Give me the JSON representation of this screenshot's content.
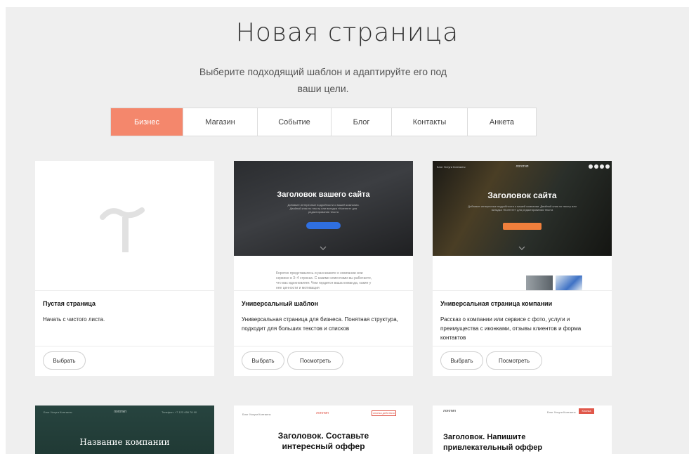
{
  "header": {
    "title": "Новая страница",
    "subtitle_line1": "Выберите подходящий шаблон и адаптируйте его под",
    "subtitle_line2": "ваши цели."
  },
  "tabs": [
    {
      "label": "Бизнес",
      "active": true
    },
    {
      "label": "Магазин",
      "active": false
    },
    {
      "label": "Событие",
      "active": false
    },
    {
      "label": "Блог",
      "active": false
    },
    {
      "label": "Контакты",
      "active": false
    },
    {
      "label": "Анкета",
      "active": false
    }
  ],
  "colors": {
    "accent": "#f4876c",
    "background": "#efefef"
  },
  "cards": [
    {
      "title": "Пустая страница",
      "description": "Начать с чистого листа.",
      "select_label": "Выбрать"
    },
    {
      "title": "Универсальный шаблон",
      "description": "Универсальная страница для бизнеса. Понятная структура, подходит для больших текстов и списков",
      "select_label": "Выбрать",
      "view_label": "Посмотреть",
      "preview": {
        "hero_title": "Заголовок вашего сайта",
        "hero_text": "Добавьте интересные подробности о вашей компании. Двойной клик по тексту или вкладка «Контент» для редактирования текста",
        "hero_button": "Кнопка действия",
        "body_text": "Коротко представьтесь и расскажите о компании или сервисе в 3–4 строках. С какими клиентами вы работаете, что вас вдохновляет. Чем гордится ваша команда, какие у нее ценности и мотивация"
      }
    },
    {
      "title": "Универсальная страница компании",
      "description": "Рассказ о компании или сервисе с фото, услуги и преимущества с иконками, отзывы клиентов и форма контактов",
      "select_label": "Выбрать",
      "view_label": "Посмотреть",
      "preview": {
        "nav": "Блог   Услуги   Контакты",
        "logo": "логотип",
        "hero_title": "Заголовок сайта",
        "hero_text": "Добавьте интересные подробности о вашей компании. Двойной клик по тексту или вкладка «Контент» для редактирования текста",
        "hero_button": "Кнопка действия"
      }
    }
  ],
  "bottom_cards": [
    {
      "nav": "Блог   Услуги   Контакты",
      "logo": "логотип",
      "phone": "Телефон: +7 123 456 78 90",
      "hero_title": "Название компании"
    },
    {
      "nav": "Блог   Услуги   Контакты",
      "logo": "логотип",
      "button": "кнопка действия",
      "hero_title_line1": "Заголовок. Составьте",
      "hero_title_line2": "интересный оффер"
    },
    {
      "nav": "Блог   Услуги   Контакты",
      "logo": "логотип",
      "button": "Кнопка",
      "hero_title_line1": "Заголовок. Напишите",
      "hero_title_line2": "привлекательный оффер"
    }
  ]
}
